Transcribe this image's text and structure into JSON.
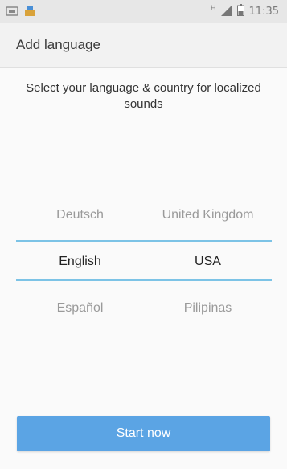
{
  "status_bar": {
    "time": "11:35",
    "network_label": "H"
  },
  "header": {
    "title": "Add language"
  },
  "subtitle": "Select your language & country for localized sounds",
  "picker": {
    "languages": [
      "Deutsch",
      "English",
      "Español"
    ],
    "countries": [
      "United Kingdom",
      "USA",
      "Pilipinas"
    ],
    "selected_language": "English",
    "selected_country": "USA"
  },
  "start_button": {
    "label": "Start now"
  },
  "colors": {
    "accent_button": "#5ba4e4",
    "divider": "#7cc3e6",
    "header_bg": "#f2f2f2"
  }
}
